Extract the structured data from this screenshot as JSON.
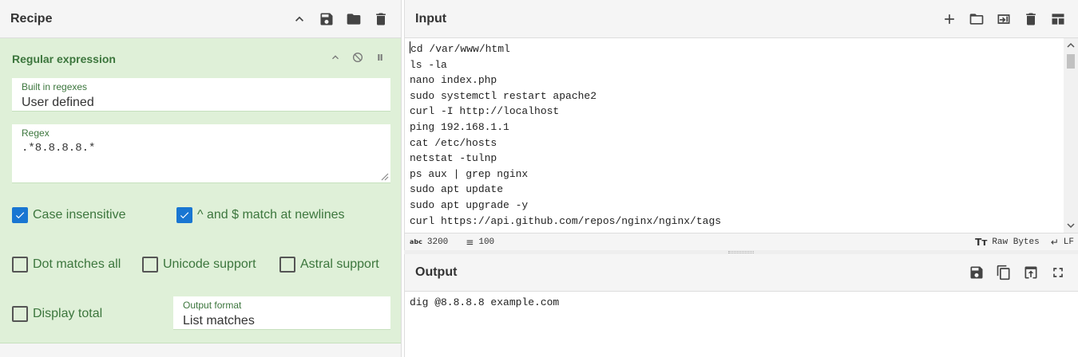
{
  "recipe": {
    "title": "Recipe",
    "icons": [
      "chevron-up-icon",
      "save-icon",
      "folder-icon",
      "trash-icon"
    ],
    "operation": {
      "title": "Regular expression",
      "builtin_label": "Built in regexes",
      "builtin_value": "User defined",
      "regex_label": "Regex",
      "regex_value": ".*8.8.8.8.*",
      "options": {
        "case_insensitive": {
          "label": "Case insensitive",
          "checked": true
        },
        "multiline": {
          "label": "^ and $ match at newlines",
          "checked": true
        },
        "dot_all": {
          "label": "Dot matches all",
          "checked": false
        },
        "unicode": {
          "label": "Unicode support",
          "checked": false
        },
        "astral": {
          "label": "Astral support",
          "checked": false
        },
        "display_total": {
          "label": "Display total",
          "checked": false
        }
      },
      "output_format_label": "Output format",
      "output_format_value": "List matches"
    }
  },
  "input": {
    "title": "Input",
    "text": "cd /var/www/html\nls -la\nnano index.php\nsudo systemctl restart apache2\ncurl -I http://localhost\nping 192.168.1.1\ncat /etc/hosts\nnetstat -tulnp\nps aux | grep nginx\nsudo apt update\nsudo apt upgrade -y\ncurl https://api.github.com/repos/nginx/nginx/tags",
    "status": {
      "chars": "3200",
      "lines": "100",
      "encoding": "Raw Bytes",
      "eol": "LF"
    }
  },
  "output": {
    "title": "Output",
    "text": "dig @8.8.8.8 example.com"
  }
}
